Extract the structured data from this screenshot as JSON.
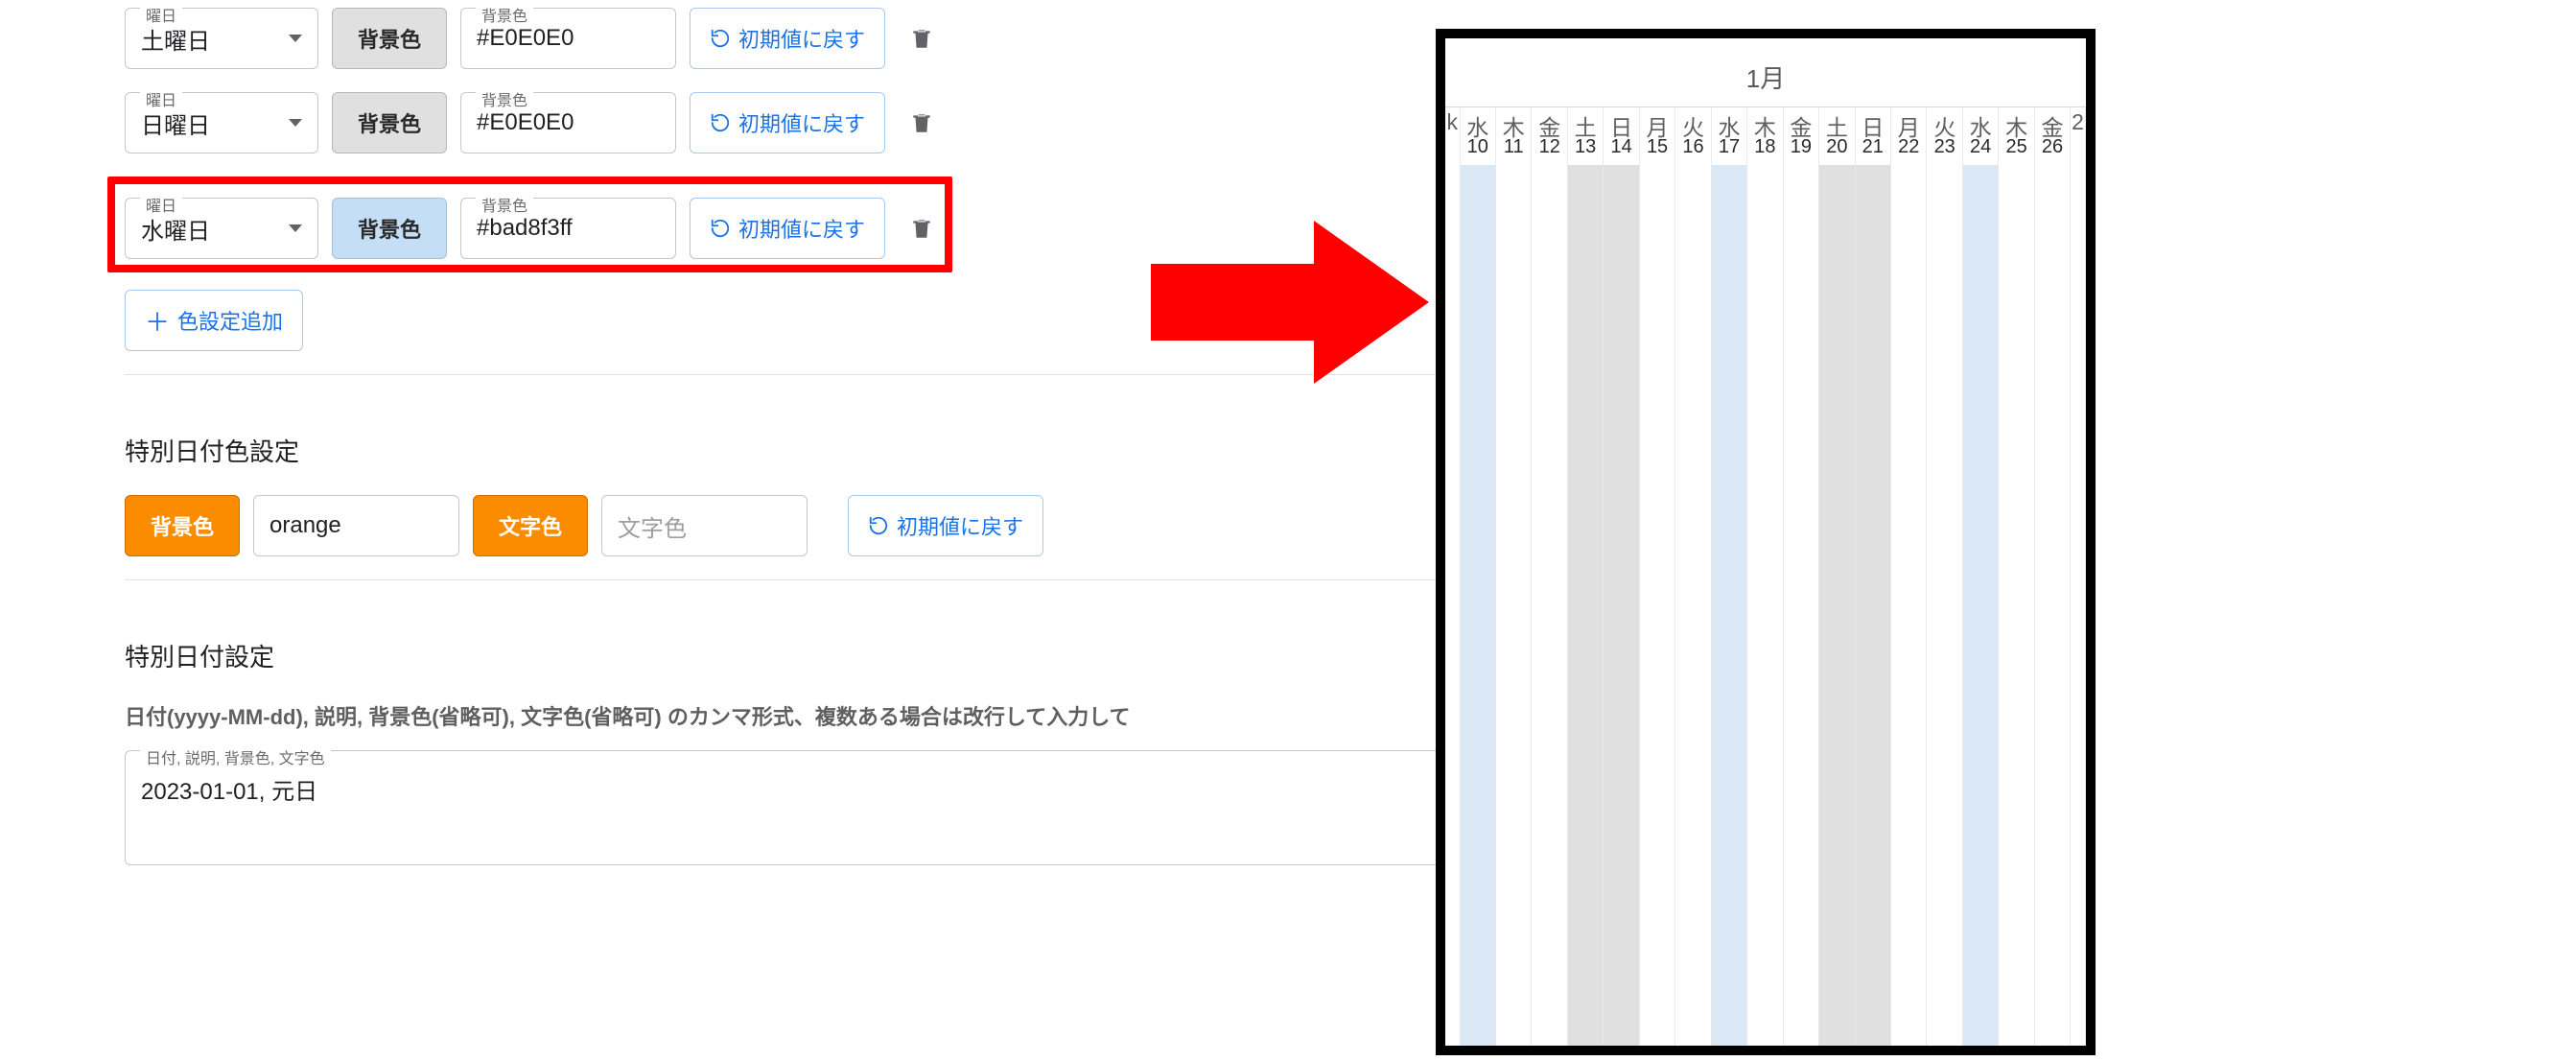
{
  "dayRows": [
    {
      "dayFieldLabel": "曜日",
      "dayValue": "土曜日",
      "bgButtonLabel": "背景色",
      "bgFieldLabel": "背景色",
      "bgValue": "#E0E0E0",
      "resetLabel": "初期値に戻す",
      "highlighted": false,
      "bgBtnStyle": "gray"
    },
    {
      "dayFieldLabel": "曜日",
      "dayValue": "日曜日",
      "bgButtonLabel": "背景色",
      "bgFieldLabel": "背景色",
      "bgValue": "#E0E0E0",
      "resetLabel": "初期値に戻す",
      "highlighted": false,
      "bgBtnStyle": "gray"
    },
    {
      "dayFieldLabel": "曜日",
      "dayValue": "水曜日",
      "bgButtonLabel": "背景色",
      "bgFieldLabel": "背景色",
      "bgValue": "#bad8f3ff",
      "resetLabel": "初期値に戻す",
      "highlighted": true,
      "bgBtnStyle": "blue-light"
    }
  ],
  "addColorLabel": "色設定追加",
  "specialColorSection": {
    "title": "特別日付色設定",
    "bgButtonLabel": "背景色",
    "bgValue": "orange",
    "fgButtonLabel": "文字色",
    "fgPlaceholder": "文字色",
    "resetLabel": "初期値に戻す"
  },
  "specialDateSection": {
    "title": "特別日付設定",
    "description": "日付(yyyy-MM-dd), 説明, 背景色(省略可), 文字色(省略可) のカンマ形式、複数ある場合は改行して入力して",
    "textareaLabel": "日付, 説明, 背景色, 文字色",
    "textareaValue": "2023-01-01, 元日"
  },
  "preview": {
    "monthLabel": "1月",
    "columns": [
      {
        "day": "k",
        "date": "",
        "cls": "",
        "partial": true
      },
      {
        "day": "水",
        "date": "10",
        "cls": "pv-wed",
        "partial": false
      },
      {
        "day": "木",
        "date": "11",
        "cls": "",
        "partial": false
      },
      {
        "day": "金",
        "date": "12",
        "cls": "",
        "partial": false
      },
      {
        "day": "土",
        "date": "13",
        "cls": "pv-sat",
        "partial": false
      },
      {
        "day": "日",
        "date": "14",
        "cls": "pv-sun",
        "partial": false
      },
      {
        "day": "月",
        "date": "15",
        "cls": "",
        "partial": false
      },
      {
        "day": "火",
        "date": "16",
        "cls": "",
        "partial": false
      },
      {
        "day": "水",
        "date": "17",
        "cls": "pv-wed",
        "partial": false
      },
      {
        "day": "木",
        "date": "18",
        "cls": "",
        "partial": false
      },
      {
        "day": "金",
        "date": "19",
        "cls": "",
        "partial": false
      },
      {
        "day": "土",
        "date": "20",
        "cls": "pv-sat",
        "partial": false
      },
      {
        "day": "日",
        "date": "21",
        "cls": "pv-sun",
        "partial": false
      },
      {
        "day": "月",
        "date": "22",
        "cls": "",
        "partial": false
      },
      {
        "day": "火",
        "date": "23",
        "cls": "",
        "partial": false
      },
      {
        "day": "水",
        "date": "24",
        "cls": "pv-wed",
        "partial": false
      },
      {
        "day": "木",
        "date": "25",
        "cls": "",
        "partial": false
      },
      {
        "day": "金",
        "date": "26",
        "cls": "",
        "partial": false
      },
      {
        "day": "2",
        "date": "",
        "cls": "",
        "partial": true
      }
    ]
  }
}
